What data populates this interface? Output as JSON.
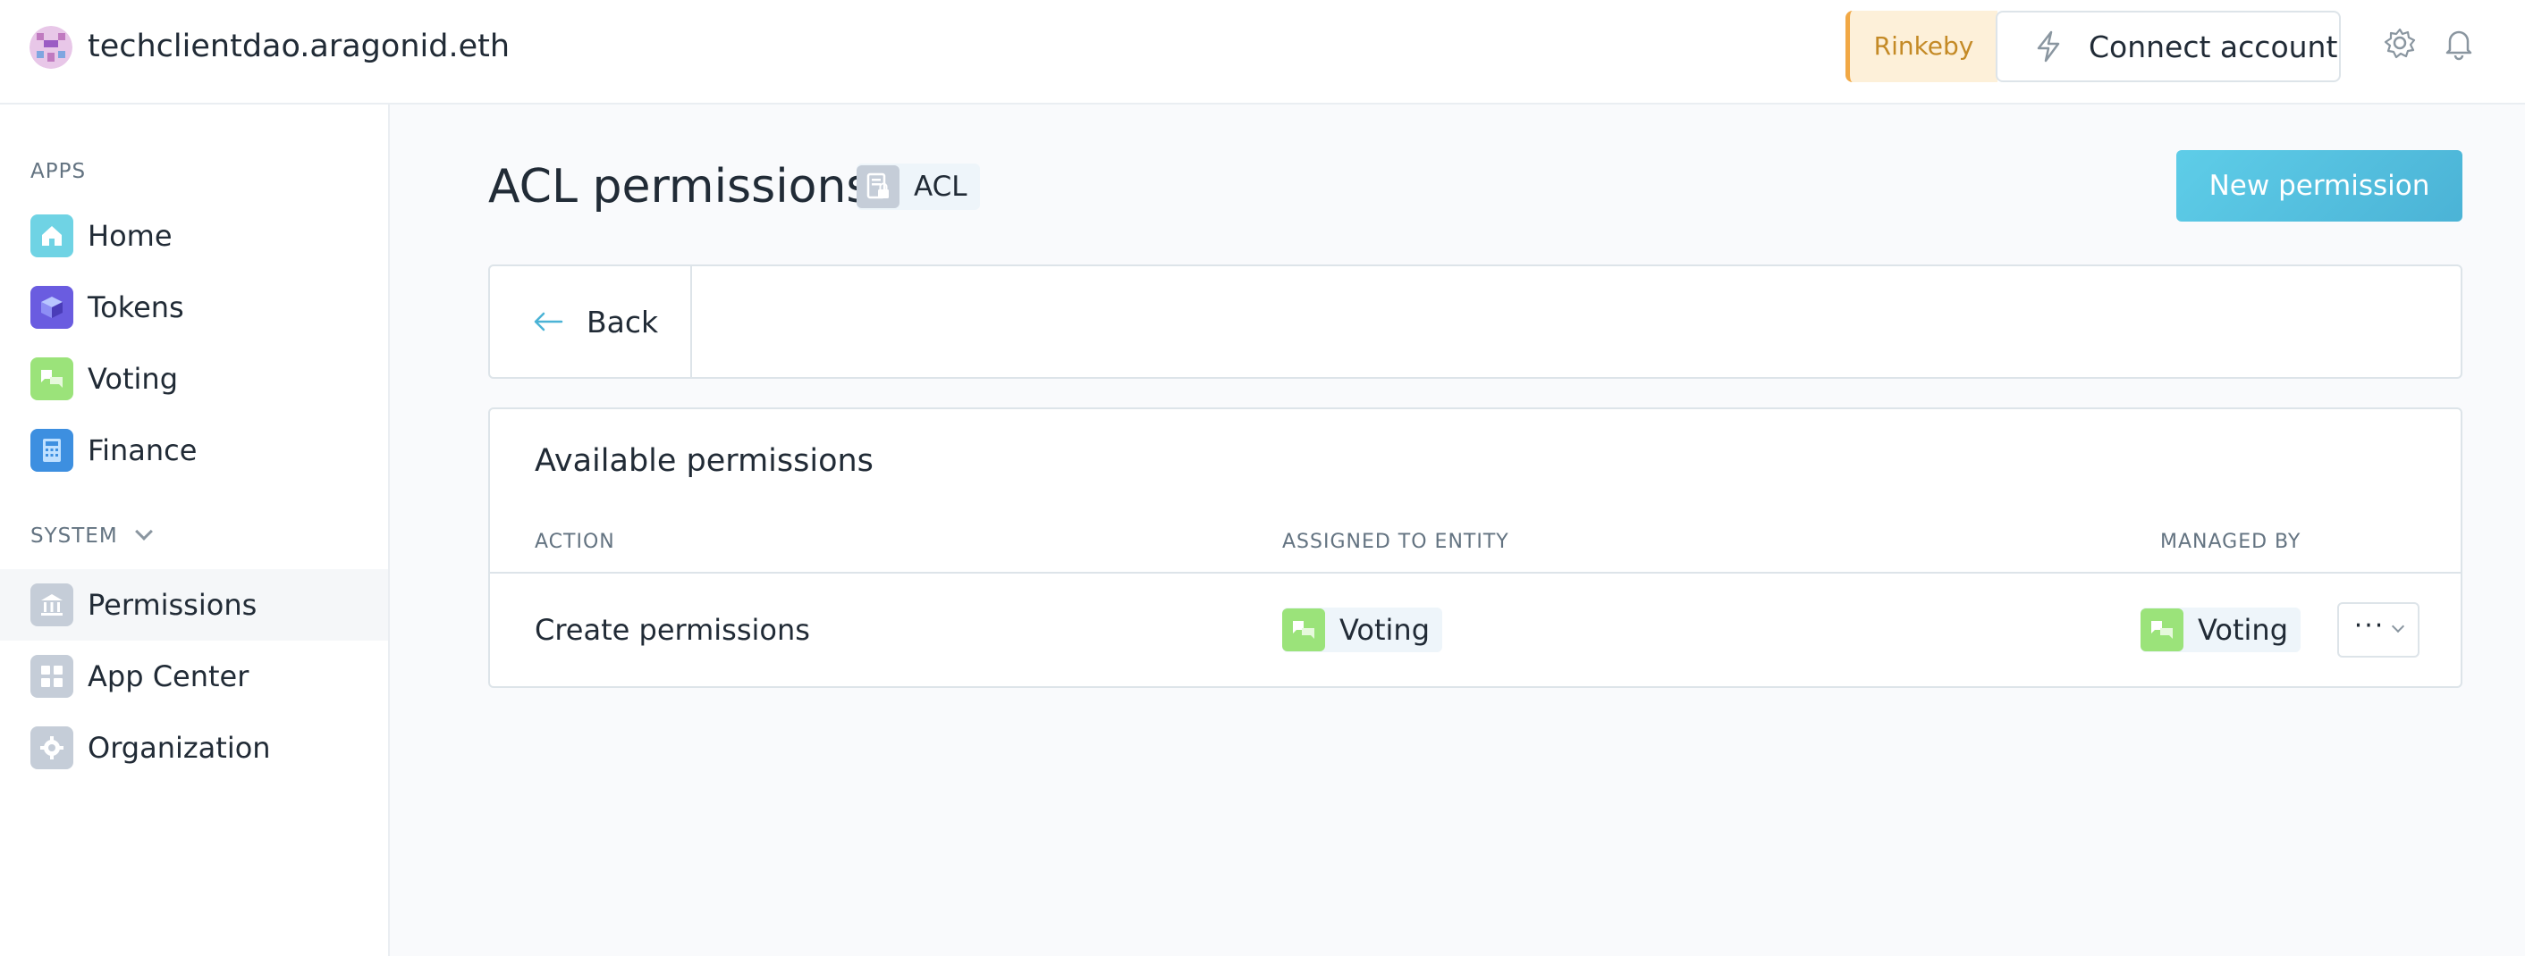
{
  "header": {
    "org_name": "techclientdao.aragonid.eth",
    "network": "Rinkeby",
    "connect_label": "Connect account"
  },
  "sidebar": {
    "apps_heading": "APPS",
    "apps": [
      {
        "label": "Home",
        "icon": "home-icon"
      },
      {
        "label": "Tokens",
        "icon": "tokens-icon"
      },
      {
        "label": "Voting",
        "icon": "voting-icon"
      },
      {
        "label": "Finance",
        "icon": "finance-icon"
      }
    ],
    "system_heading": "SYSTEM",
    "system": [
      {
        "label": "Permissions",
        "icon": "permissions-icon",
        "active": true
      },
      {
        "label": "App Center",
        "icon": "app-center-icon"
      },
      {
        "label": "Organization",
        "icon": "organization-icon"
      }
    ]
  },
  "main": {
    "title": "ACL permissions",
    "app_badge": "ACL",
    "new_permission_label": "New permission",
    "back_label": "Back",
    "panel_title": "Available permissions",
    "columns": [
      "ACTION",
      "ASSIGNED TO ENTITY",
      "MANAGED BY"
    ],
    "rows": [
      {
        "action": "Create permissions",
        "assigned_to": "Voting",
        "managed_by": "Voting"
      }
    ]
  },
  "colors": {
    "accent": "#4bb3d6",
    "network_bg": "#fdf0d9",
    "network_text": "#c48a26",
    "voting_icon": "#9be37a"
  }
}
